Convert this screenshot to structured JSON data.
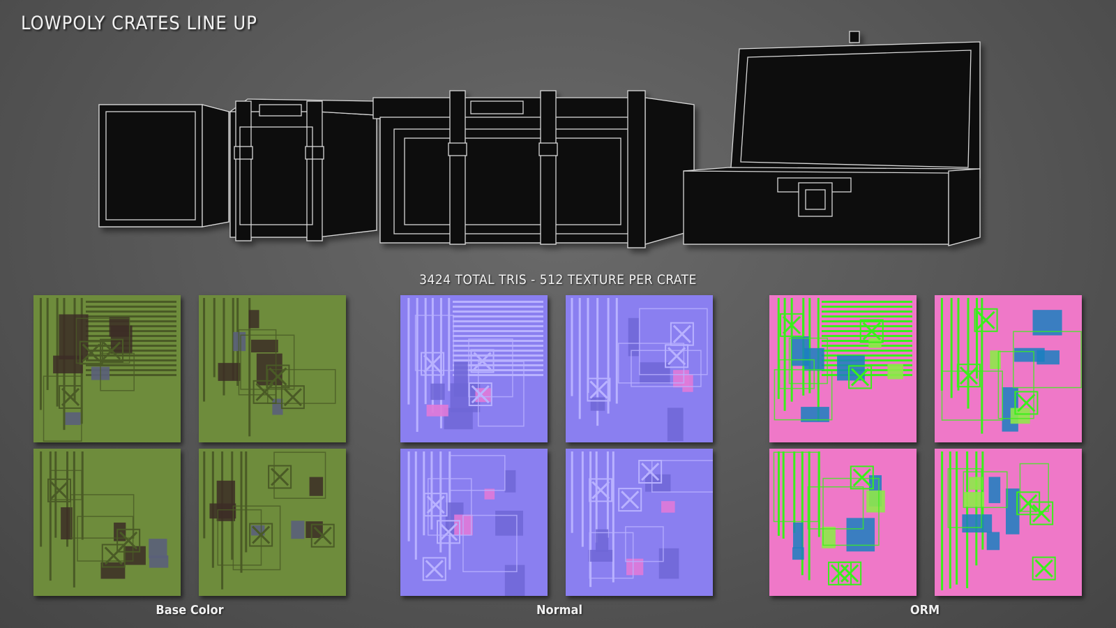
{
  "title": "LOWPOLY CRATES LINE UP",
  "stats": "3424 TOTAL TRIS - 512 TEXTURE PER CRATE",
  "groups": [
    {
      "label": "Base Color",
      "colors": {
        "bg": "#6e8c3c",
        "dark": "#3c2d26",
        "line": "#4a5a26",
        "accent": "#5a5f7a"
      }
    },
    {
      "label": "Normal",
      "colors": {
        "bg": "#8a7ff0",
        "dark": "#6e66d6",
        "line": "#b9b2ff",
        "accent": "#e07ad8"
      }
    },
    {
      "label": "ORM",
      "colors": {
        "bg": "#ef78c8",
        "dark": "#1a7fc0",
        "line": "#39f01a",
        "accent": "#8fe84a"
      }
    }
  ]
}
